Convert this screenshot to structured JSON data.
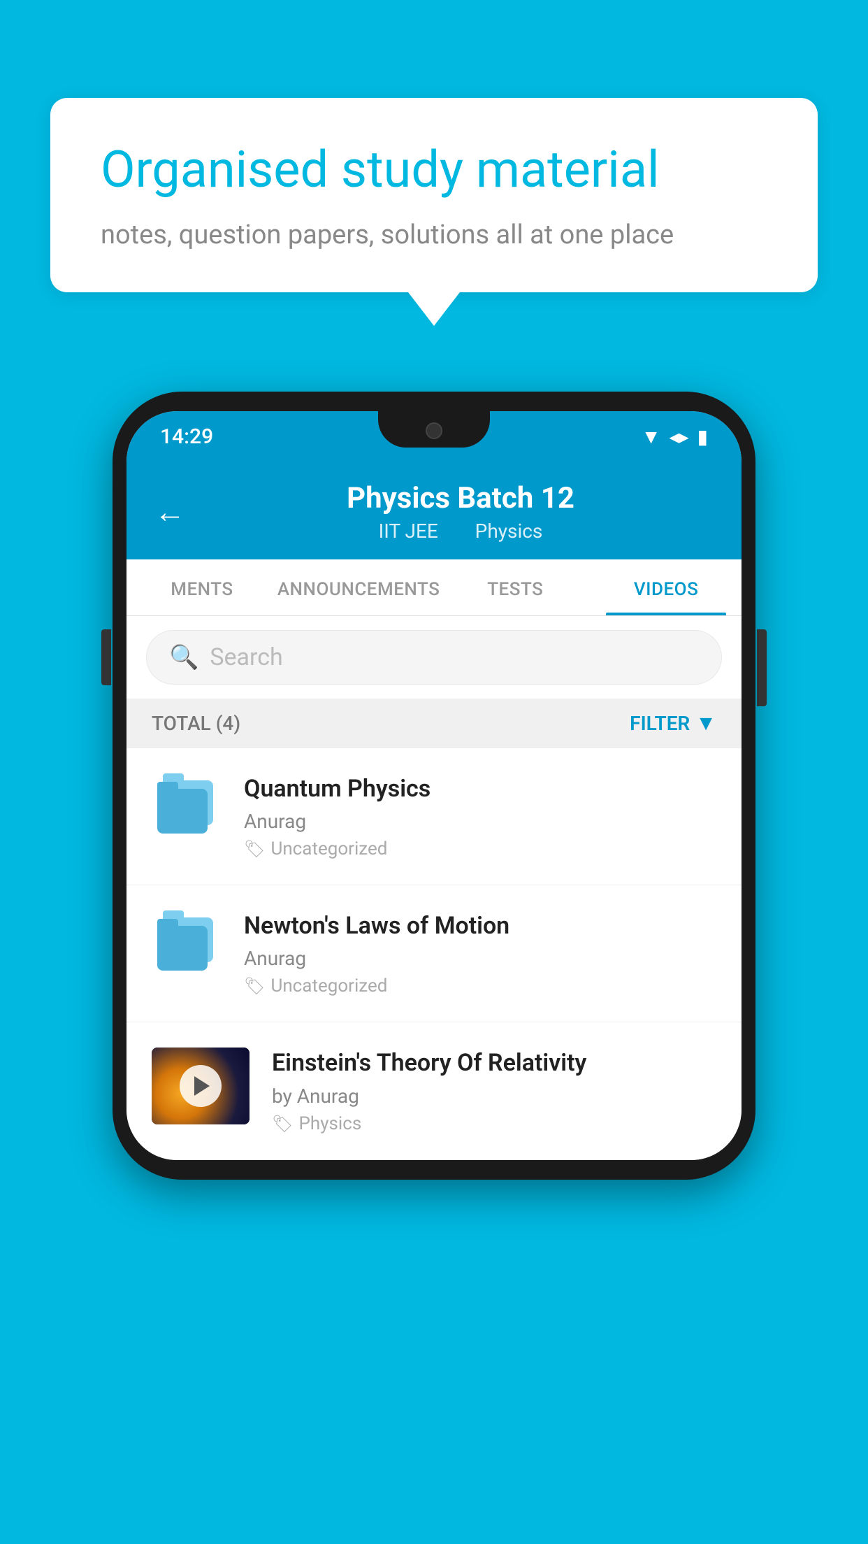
{
  "background_color": "#00b8e0",
  "speech_bubble": {
    "title": "Organised study material",
    "subtitle": "notes, question papers, solutions all at one place"
  },
  "phone": {
    "status_bar": {
      "time": "14:29",
      "icons": [
        "wifi",
        "signal",
        "battery"
      ]
    },
    "header": {
      "title": "Physics Batch 12",
      "subtitle_parts": [
        "IIT JEE",
        "Physics"
      ],
      "back_label": "Back"
    },
    "tabs": [
      {
        "label": "MENTS",
        "active": false
      },
      {
        "label": "ANNOUNCEMENTS",
        "active": false
      },
      {
        "label": "TESTS",
        "active": false
      },
      {
        "label": "VIDEOS",
        "active": true
      }
    ],
    "search": {
      "placeholder": "Search"
    },
    "filter_bar": {
      "total_label": "TOTAL (4)",
      "filter_label": "FILTER"
    },
    "videos": [
      {
        "id": 1,
        "title": "Quantum Physics",
        "author": "Anurag",
        "tag": "Uncategorized",
        "has_thumbnail": false
      },
      {
        "id": 2,
        "title": "Newton's Laws of Motion",
        "author": "Anurag",
        "tag": "Uncategorized",
        "has_thumbnail": false
      },
      {
        "id": 3,
        "title": "Einstein's Theory Of Relativity",
        "author": "by Anurag",
        "tag": "Physics",
        "has_thumbnail": true
      }
    ]
  }
}
